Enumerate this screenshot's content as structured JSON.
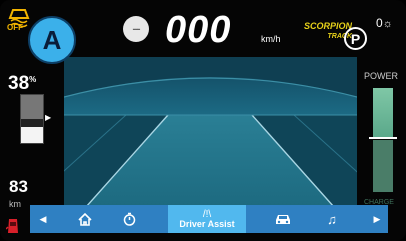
{
  "header": {
    "esc_off_label": "OFF",
    "callout_label": "A",
    "speed_limit_text": "---",
    "speed_value": "000",
    "speed_unit": "km/h",
    "drive_mode_line1": "SCORPION",
    "drive_mode_line2": "TRACK",
    "gear": "P",
    "light_icon": "0",
    "icons": [
      "esc-off-icon",
      "speed-limit-icon",
      "park-icon",
      "headlight-icon"
    ]
  },
  "battery": {
    "soc_value": "38",
    "soc_unit": "%",
    "soc_level": 0.38,
    "range_value": "83",
    "range_unit": "km"
  },
  "power": {
    "title": "POWER",
    "charge_label": "CHARGE"
  },
  "nav": {
    "items": [
      {
        "name": "home",
        "icon": "home-icon",
        "label": ""
      },
      {
        "name": "timer",
        "icon": "timer-icon",
        "label": ""
      },
      {
        "name": "driver-assist",
        "icon": "driver-assist-icon",
        "label": "Driver Assist",
        "selected": true
      },
      {
        "name": "vehicle",
        "icon": "car-icon",
        "label": ""
      },
      {
        "name": "music",
        "icon": "music-icon",
        "label": ""
      }
    ],
    "prev_icon": "chevron-left-icon",
    "next_icon": "chevron-right-icon"
  },
  "colors": {
    "accent": "#2f80c2",
    "selected": "#51b8ee",
    "display_bg": "#0f3f52",
    "power_green": "#7fc7a6",
    "mode_yellow": "#e8d21a",
    "callout": "#3bb0ea"
  }
}
